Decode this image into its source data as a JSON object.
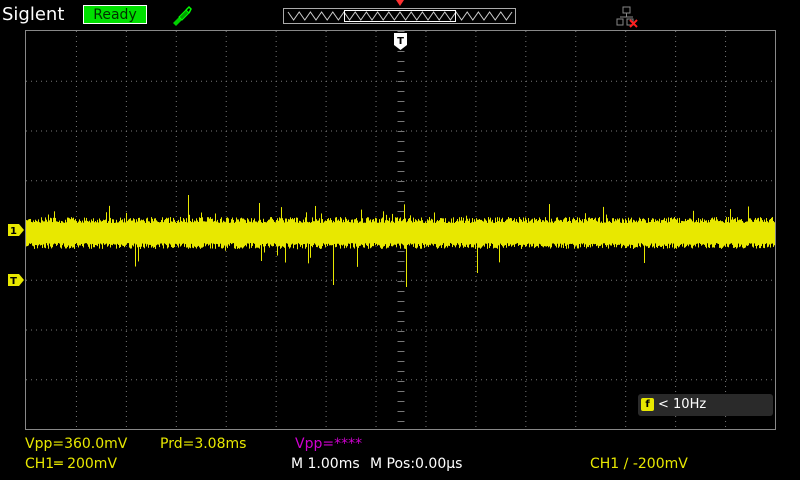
{
  "header": {
    "brand": "Siglent",
    "status": "Ready",
    "icons": {
      "probe": "probe-icon",
      "usb": "usb-disconnected-icon"
    }
  },
  "colors": {
    "ch1": "#e8e800",
    "status_bg": "#00e000",
    "math": "#d000d0"
  },
  "markers": {
    "trigger_position": "T",
    "ch1": "1",
    "trigger_level": "T"
  },
  "frequency": {
    "icon": "f",
    "value": "< 10Hz"
  },
  "measurements": {
    "vpp_ch1": "Vpp=360.0mV",
    "prd_ch1": "Prd=3.08ms",
    "vpp_ch2": "Vpp=****"
  },
  "footer": {
    "ch1_scale": "CH1═ 200mV",
    "timebase": "M 1.00ms",
    "mpos": "M Pos:0.00µs",
    "trigger": "CH1 ∕ -200mV"
  }
}
